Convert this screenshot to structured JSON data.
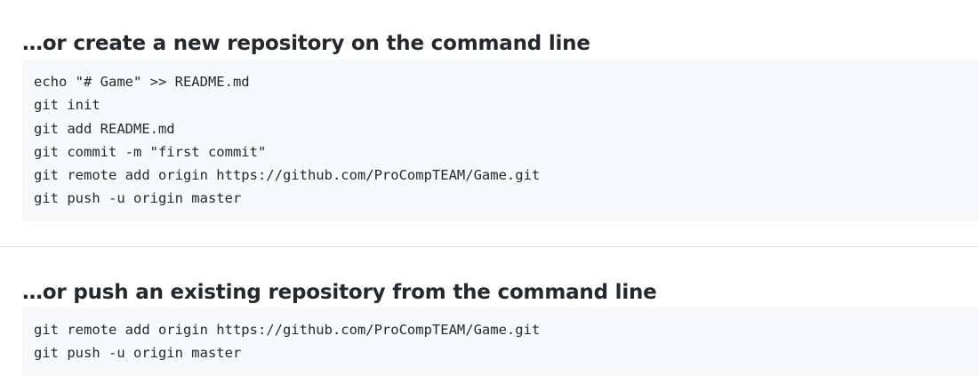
{
  "create_section": {
    "heading": "…or create a new repository on the command line",
    "code_lines": [
      "echo \"# Game\" >> README.md",
      "git init",
      "git add README.md",
      "git commit -m \"first commit\"",
      "git remote add origin https://github.com/ProCompTEAM/Game.git",
      "git push -u origin master"
    ]
  },
  "push_section": {
    "heading": "…or push an existing repository from the command line",
    "code_lines": [
      "git remote add origin https://github.com/ProCompTEAM/Game.git",
      "git push -u origin master"
    ]
  },
  "colors": {
    "heading_text": "#24292e",
    "code_background": "#f6f8fa",
    "code_text": "#24292e",
    "divider": "#e1e4e8"
  }
}
